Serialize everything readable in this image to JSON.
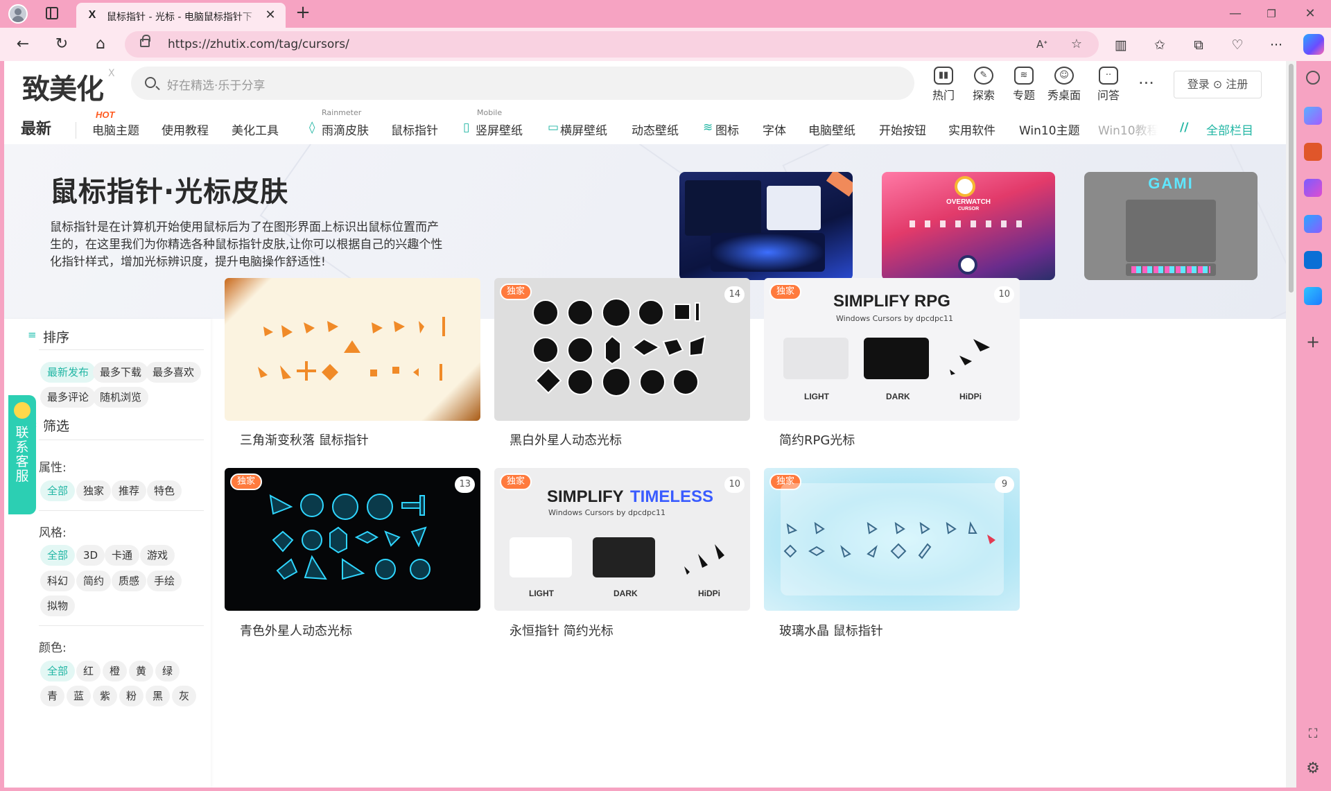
{
  "browser": {
    "tab_title": "鼠标指针 - 光标 - 电脑鼠标指针下",
    "tab_favicon": "X",
    "url": "https://zhutix.com/tag/cursors/"
  },
  "site": {
    "logo": "致美化",
    "logo_mark": "X",
    "search_placeholder": "好在精选·乐于分享",
    "top_nav": [
      "热门",
      "探索",
      "专题",
      "秀桌面",
      "问答"
    ],
    "top_nav_icons": [
      "hot-icon",
      "explore-icon",
      "topics-icon",
      "desktop-show-icon",
      "qa-icon"
    ],
    "more": "···",
    "login": "登录 ⊙ 注册"
  },
  "categories": {
    "newest": "最新",
    "hot_tag": "HOT",
    "items": [
      "电脑主题",
      "使用教程",
      "美化工具",
      "雨滴皮肤",
      "鼠标指针",
      "竖屏壁纸",
      "横屏壁纸",
      "动态壁纸",
      "图标",
      "字体",
      "电脑壁纸",
      "开始按钮",
      "实用软件",
      "Win10主题",
      "Win10教程"
    ],
    "sup_rainmeter": "Rainmeter",
    "sup_mobile": "Mobile",
    "all_columns": "全部栏目"
  },
  "banner": {
    "title": "鼠标指针·光标皮肤",
    "desc": "鼠标指针是在计算机开始使用鼠标后为了在图形界面上标识出鼠标位置而产生的，在这里我们为你精选各种鼠标指针皮肤,让你可以根据自己的兴趣个性化指针样式，增加光标辨识度，提升电脑操作舒适性!",
    "feature2_title": "OVERWATCH",
    "feature2_sub": "CURSOR",
    "feature3_title": "GAMI"
  },
  "sidebar": {
    "sort_title": "排序",
    "sort_chips": [
      "最新发布",
      "最多下载",
      "最多喜欢",
      "最多评论",
      "随机浏览"
    ],
    "filter_title": "筛选",
    "attr_label": "属性:",
    "attr_chips": [
      "全部",
      "独家",
      "推荐",
      "特色"
    ],
    "style_label": "风格:",
    "style_chips": [
      "全部",
      "3D",
      "卡通",
      "游戏",
      "科幻",
      "简约",
      "质感",
      "手绘",
      "拟物"
    ],
    "color_label": "颜色:",
    "color_chips": [
      "全部",
      "红",
      "橙",
      "黄",
      "绿",
      "青",
      "蓝",
      "紫",
      "粉",
      "黑",
      "灰"
    ],
    "contact": "联系客服"
  },
  "cards": [
    {
      "title": "三角渐变秋落 鼠标指针",
      "badge": "",
      "count": ""
    },
    {
      "title": "黑白外星人动态光标",
      "badge": "独家",
      "count": "14"
    },
    {
      "title": "简约RPG光标",
      "badge": "独家",
      "count": "10",
      "big": "SIMPLIFY RPG",
      "sub": "Windows Cursors by dpcdpc11",
      "labels": [
        "LIGHT",
        "DARK",
        "HiDPi"
      ]
    },
    {
      "title": "青色外星人动态光标",
      "badge": "独家",
      "count": "13"
    },
    {
      "title": "永恒指针 简约光标",
      "badge": "独家",
      "count": "10",
      "big1": "SIMPLIFY",
      "big2": "TIMELESS",
      "sub": "Windows Cursors by dpcdpc11",
      "labels": [
        "LIGHT",
        "DARK",
        "HiDPi"
      ]
    },
    {
      "title": "玻璃水晶 鼠标指针",
      "badge": "独家",
      "count": "9"
    }
  ],
  "colors": {
    "accent": "#22b6a4",
    "badge": "#ff7a3d",
    "chrome": "#f6a3c2"
  }
}
